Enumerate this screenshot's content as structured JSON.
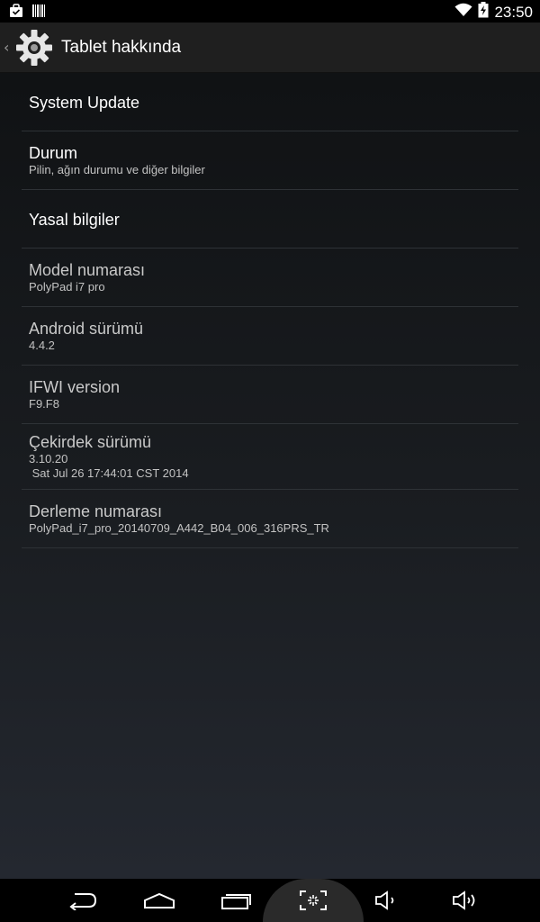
{
  "status_bar": {
    "time": "23:50",
    "icons_left": [
      "shopping-bag-icon",
      "barcode-icon"
    ],
    "icons_right": [
      "wifi-icon",
      "battery-charging-icon"
    ]
  },
  "action_bar": {
    "title": "Tablet hakkında",
    "icon": "settings-gear-icon"
  },
  "preferences": [
    {
      "title": "System Update",
      "summary": ""
    },
    {
      "title": "Durum",
      "summary": "Pilin, ağın durumu ve diğer bilgiler"
    },
    {
      "title": "Yasal bilgiler",
      "summary": ""
    },
    {
      "title": "Model numarası",
      "summary": "PolyPad i7 pro"
    },
    {
      "title": "Android sürümü",
      "summary": "4.4.2"
    },
    {
      "title": "IFWI version",
      "summary": "F9.F8"
    },
    {
      "title": "Çekirdek sürümü",
      "summary": "3.10.20\n Sat Jul 26 17:44:01 CST 2014"
    },
    {
      "title": "Derleme numarası",
      "summary": "PolyPad_i7_pro_20140709_A442_B04_006_316PRS_TR"
    }
  ],
  "nav_bar": {
    "buttons": [
      "back-icon",
      "home-icon",
      "recent-apps-icon",
      "screenshot-icon",
      "volume-down-icon",
      "volume-up-icon"
    ]
  },
  "colors": {
    "action_bar_bg": "#1f1f1f",
    "divider": "#2e3236"
  }
}
